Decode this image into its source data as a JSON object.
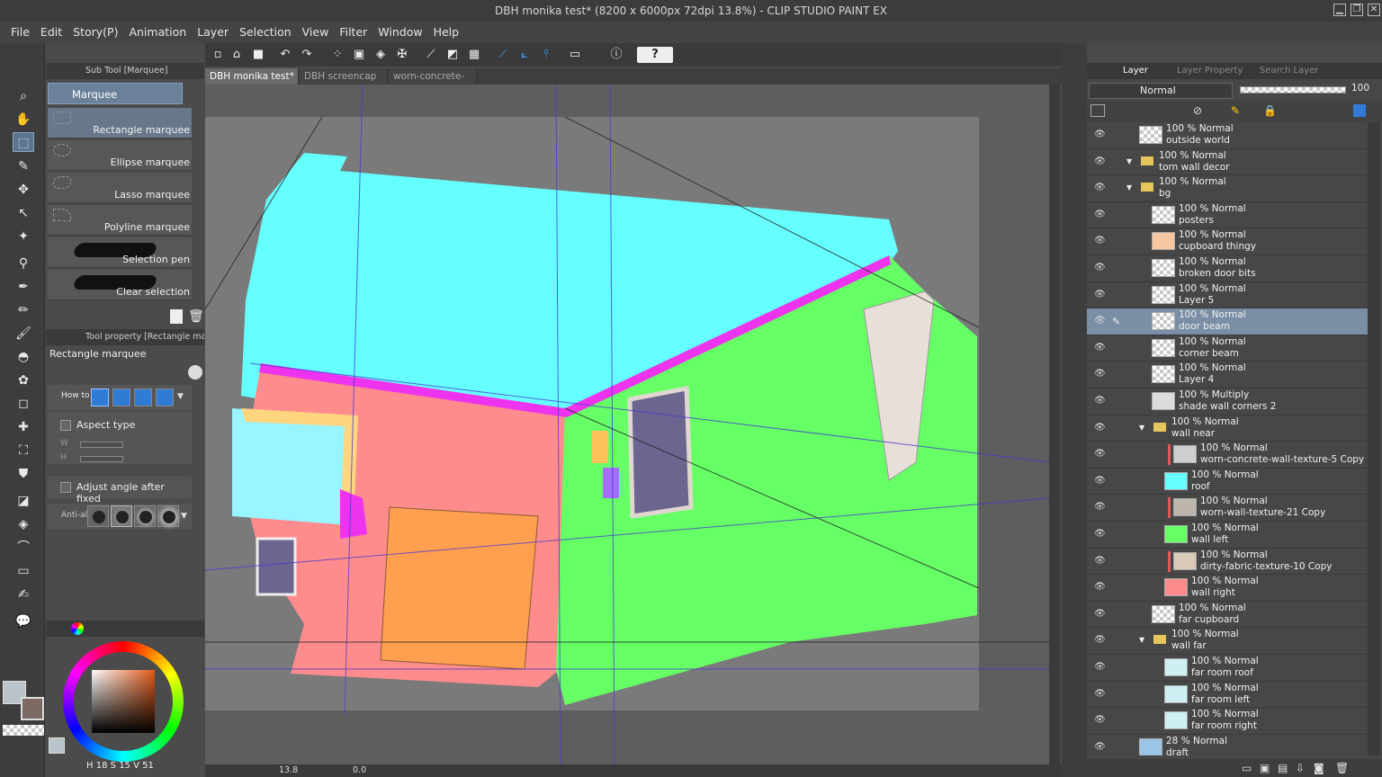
{
  "window": {
    "title": "DBH monika test* (8200 x 6000px 72dpi 13.8%) - CLIP STUDIO PAINT EX",
    "minimize": "▁",
    "restore": "❐",
    "close": "✕"
  },
  "menu": [
    "File",
    "Edit",
    "Story(P)",
    "Animation",
    "Layer",
    "Selection",
    "View",
    "Filter",
    "Window",
    "Help"
  ],
  "toolbar": {
    "icons": [
      "new-file-icon",
      "open-file-icon",
      "save-icon",
      "undo-icon",
      "redo-icon",
      "selection-icon",
      "transform-icon",
      "fill-icon",
      "crop-icon",
      "ruler-icon",
      "perspective-icon",
      "grid-icon",
      "snap-ruler-icon",
      "snap-special-icon",
      "snap-grid-icon",
      "screen-icon",
      "info-icon",
      "help-icon"
    ],
    "help_label": "?"
  },
  "tabs": [
    {
      "label": "DBH monika test*",
      "active": true
    },
    {
      "label": "DBH screencap",
      "active": false
    },
    {
      "label": "worn-concrete-",
      "active": false
    }
  ],
  "subtool": {
    "header": "Sub Tool [Marquee]",
    "group": "Marquee",
    "items": [
      {
        "label": "Rectangle marquee",
        "selected": true
      },
      {
        "label": "Ellipse marquee",
        "selected": false
      },
      {
        "label": "Lasso marquee",
        "selected": false
      },
      {
        "label": "Polyline marquee",
        "selected": false
      },
      {
        "label": "Selection pen",
        "selected": false
      },
      {
        "label": "Clear selection",
        "selected": false
      }
    ]
  },
  "toolproperty": {
    "header": "Tool property [Rectangle mar",
    "title": "Rectangle marquee",
    "how_to": "How to",
    "aspect_type": "Aspect type",
    "w": "W",
    "h": "H",
    "adjust_angle": "Adjust angle after fixed",
    "anti_alias": "Anti-ali"
  },
  "color": {
    "main": "#b9c3c9",
    "sub": "#7d6963",
    "h": "18",
    "s": "15",
    "v": "51",
    "h_label": "H",
    "s_label": "S",
    "v_label": "V"
  },
  "status": {
    "zoom": "13.8",
    "angle": "0.0"
  },
  "layers": {
    "tabs": [
      "Layer",
      "Layer Property",
      "Search Layer"
    ],
    "blend": "Normal",
    "opacity": "100",
    "items": [
      {
        "mode": "100 % Normal",
        "name": "outside world",
        "indent": 0,
        "type": "layer",
        "thumb": "#f4f4f4"
      },
      {
        "mode": "100 % Normal",
        "name": "torn wall decor",
        "indent": 0,
        "type": "folder"
      },
      {
        "mode": "100 % Normal",
        "name": "bg",
        "indent": 0,
        "type": "folder"
      },
      {
        "mode": "100 % Normal",
        "name": "posters",
        "indent": 1,
        "type": "layer",
        "thumb": "#f4f4f4"
      },
      {
        "mode": "100 % Normal",
        "name": "cupboard thingy",
        "indent": 1,
        "type": "layer",
        "thumb": "#f6c7a0"
      },
      {
        "mode": "100 % Normal",
        "name": "broken door bits",
        "indent": 1,
        "type": "layer",
        "thumb": "#f4f4f4"
      },
      {
        "mode": "100 % Normal",
        "name": "Layer 5",
        "indent": 1,
        "type": "layer",
        "thumb": "#f4f4f4"
      },
      {
        "mode": "100 % Normal",
        "name": "door beam",
        "indent": 1,
        "type": "layer",
        "thumb": "#f4f4f4",
        "selected": true
      },
      {
        "mode": "100 % Normal",
        "name": "corner beam",
        "indent": 1,
        "type": "layer",
        "thumb": "#f4f4f4"
      },
      {
        "mode": "100 % Normal",
        "name": "Layer 4",
        "indent": 1,
        "type": "layer",
        "thumb": "#f4f4f4"
      },
      {
        "mode": "100 % Multiply",
        "name": "shade wall corners 2",
        "indent": 1,
        "type": "layer",
        "thumb": "#dcdcdc"
      },
      {
        "mode": "100 % Normal",
        "name": "wall near",
        "indent": 1,
        "type": "folder"
      },
      {
        "mode": "100 % Normal",
        "name": "worn-concrete-wall-texture-5 Copy",
        "indent": 2,
        "type": "layer",
        "thumb": "#cfcfcf",
        "mark": true
      },
      {
        "mode": "100 % Normal",
        "name": "roof",
        "indent": 2,
        "type": "layer",
        "thumb": "#66ffff"
      },
      {
        "mode": "100 % Normal",
        "name": "worn-wall-texture-21 Copy",
        "indent": 2,
        "type": "layer",
        "thumb": "#bdb6ad",
        "mark": true
      },
      {
        "mode": "100 % Normal",
        "name": "wall left",
        "indent": 2,
        "type": "layer",
        "thumb": "#66ff66"
      },
      {
        "mode": "100 % Normal",
        "name": "dirty-fabric-texture-10 Copy",
        "indent": 2,
        "type": "layer",
        "thumb": "#d9c9b8",
        "mark": true
      },
      {
        "mode": "100 % Normal",
        "name": "wall right",
        "indent": 2,
        "type": "layer",
        "thumb": "#ff8c8c"
      },
      {
        "mode": "100 % Normal",
        "name": "far cupboard",
        "indent": 1,
        "type": "layer",
        "thumb": "#f4f4f4"
      },
      {
        "mode": "100 % Normal",
        "name": "wall far",
        "indent": 1,
        "type": "folder"
      },
      {
        "mode": "100 % Normal",
        "name": "far room roof",
        "indent": 2,
        "type": "layer",
        "thumb": "#cfeff5"
      },
      {
        "mode": "100 % Normal",
        "name": "far room left",
        "indent": 2,
        "type": "layer",
        "thumb": "#cfeff5"
      },
      {
        "mode": "100 % Normal",
        "name": "far room right",
        "indent": 2,
        "type": "layer",
        "thumb": "#cfeff5"
      },
      {
        "mode": "28 % Normal",
        "name": "draft",
        "indent": 0,
        "type": "layer",
        "thumb": "#9cc4e6"
      }
    ]
  },
  "canvas_colors": {
    "ceiling": "#66ffff",
    "left_wall": "#ff8c8c",
    "right_wall": "#66ff66",
    "trim": "#ee33ee",
    "cupboard": "#ffa050",
    "door": "#ffd580",
    "window_glass": "#6b6590"
  }
}
